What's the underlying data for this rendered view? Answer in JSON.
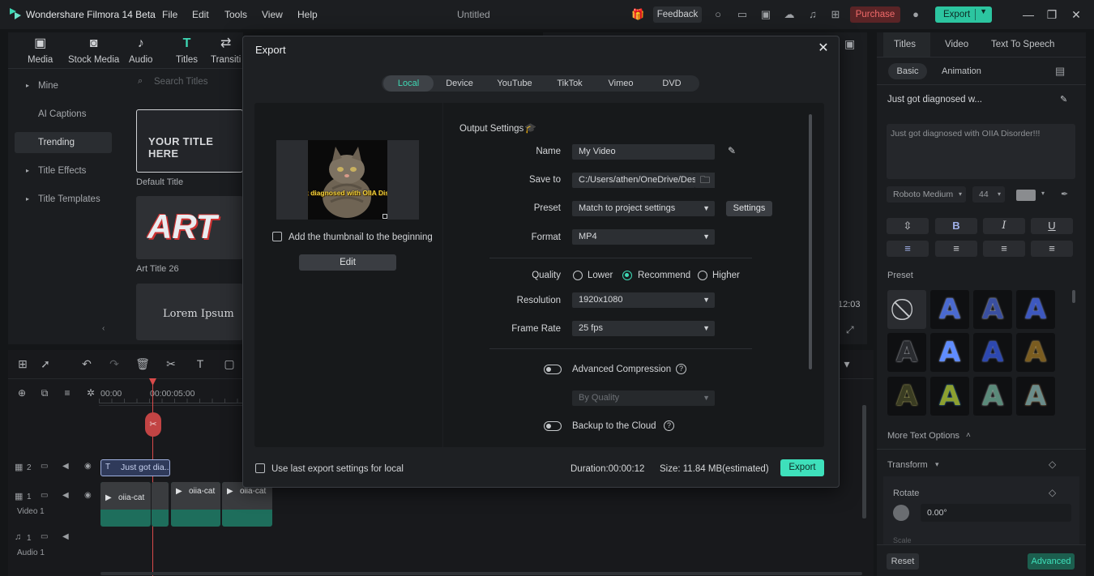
{
  "app": {
    "title": "Wondershare Filmora 14 Beta",
    "doc_title": "Untitled",
    "menu": [
      "File",
      "Edit",
      "Tools",
      "View",
      "Help"
    ],
    "feedback": "Feedback",
    "purchase": "Purchase",
    "export": "Export"
  },
  "media": {
    "tabs": [
      "Media",
      "Stock Media",
      "Audio",
      "Titles",
      "Transiti"
    ],
    "categories": [
      "Mine",
      "AI Captions",
      "Trending",
      "Title Effects",
      "Title Templates"
    ],
    "search_placeholder": "Search Titles",
    "thumbs": {
      "default_text": "YOUR TITLE HERE",
      "default_label": "Default Title",
      "art_text": "ART",
      "art_label": "Art Title 26",
      "lorem_text": "Lorem Ipsum"
    }
  },
  "timeline": {
    "ruler": [
      "00:00",
      "00:00:05:00"
    ],
    "tracks": {
      "title_clip": "Just got dia...",
      "video_label": "Video 1",
      "audio_label": "Audio 1",
      "clips": [
        "oiia-cat",
        "oiia-cat",
        "oiia-cat"
      ],
      "track2": "2",
      "track1": "1",
      "audio1": "1"
    },
    "player_time": "12:03"
  },
  "props": {
    "tabs": [
      "Titles",
      "Video",
      "Text To Speech"
    ],
    "subtabs": [
      "Basic",
      "Animation"
    ],
    "clip_name": "Just got diagnosed w...",
    "text_value": "Just got diagnosed with OIIA Disorder!!!",
    "font": "Roboto Medium",
    "font_size": "44",
    "preset_label": "Preset",
    "more_options": "More Text Options",
    "transform": "Transform",
    "rotate": "Rotate",
    "rotate_value": "0.00°",
    "scale": "Scale",
    "reset": "Reset",
    "advanced": "Advanced"
  },
  "dialog": {
    "title": "Export",
    "tabs": [
      "Local",
      "Device",
      "YouTube",
      "TikTok",
      "Vimeo",
      "DVD"
    ],
    "preview_caption": "Just got diagnosed with OIIA Disorder!!!",
    "add_thumbnail": "Add the thumbnail to the beginning",
    "edit": "Edit",
    "output_settings": "Output Settings",
    "fields": {
      "name_label": "Name",
      "name_value": "My Video",
      "save_label": "Save to",
      "save_value": "C:/Users/athen/OneDrive/Desk",
      "preset_label": "Preset",
      "preset_value": "Match to project settings",
      "settings_btn": "Settings",
      "format_label": "Format",
      "format_value": "MP4",
      "quality_label": "Quality",
      "quality_options": [
        "Lower",
        "Recommend",
        "Higher"
      ],
      "quality_selected": "Recommend",
      "resolution_label": "Resolution",
      "resolution_value": "1920x1080",
      "framerate_label": "Frame Rate",
      "framerate_value": "25 fps",
      "adv_compression": "Advanced Compression",
      "by_quality": "By Quality",
      "backup": "Backup to the Cloud"
    },
    "footer": {
      "use_last": "Use last export settings for local",
      "duration": "Duration:00:00:12",
      "size": "Size: 11.84 MB(estimated)",
      "export": "Export"
    }
  },
  "colors": {
    "accent": "#3ed9b5",
    "purchase": "#f06a6a"
  }
}
